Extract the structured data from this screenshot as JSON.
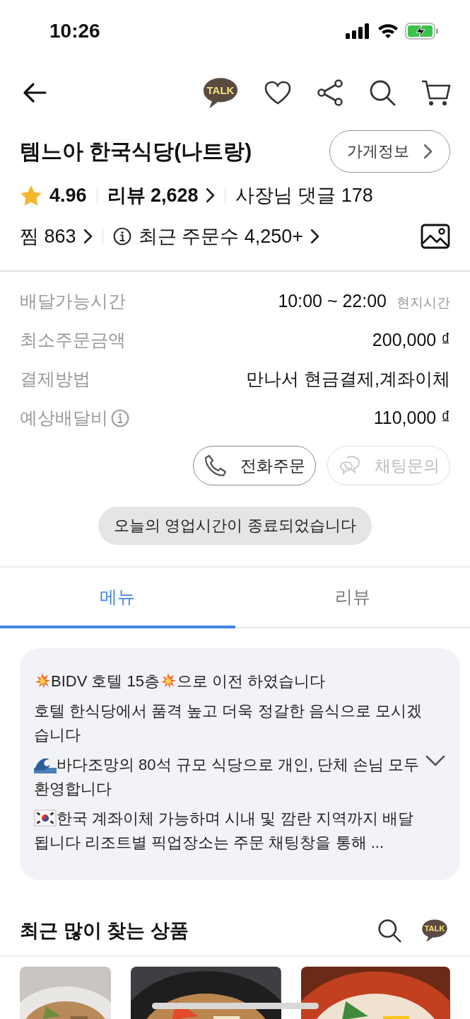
{
  "status_bar": {
    "time": "10:26"
  },
  "nav": {
    "talk_badge": "TALK"
  },
  "store": {
    "name": "템느아 한국식당(나트랑)",
    "info_button": "가게정보",
    "rating": "4.96",
    "reviews": "리뷰 2,628",
    "owner_replies": "사장님 댓글 178",
    "likes": "찜 863",
    "recent_orders": "최근 주문수 4,250+"
  },
  "info_rows": [
    {
      "label": "배달가능시간",
      "value": "10:00 ~ 22:00",
      "note": "현지시간",
      "info": false
    },
    {
      "label": "최소주문금액",
      "value": "200,000 ₫",
      "info": false
    },
    {
      "label": "결제방법",
      "value": "만나서 현금결제,계좌이체",
      "info": false
    },
    {
      "label": "예상배달비",
      "value": "110,000 ₫",
      "info": true
    }
  ],
  "contact_buttons": [
    {
      "label": "전화주문",
      "kind": "phone",
      "disabled": false
    },
    {
      "label": "채팅문의",
      "kind": "chat",
      "disabled": true
    }
  ],
  "closed_notice": "오늘의 영업시간이 종료되었습니다",
  "tabs": [
    {
      "label": "메뉴",
      "selected": true
    },
    {
      "label": "리뷰",
      "selected": false
    }
  ],
  "notice": {
    "expanded": false,
    "lines": [
      [
        {
          "kind": "burst"
        },
        {
          "kind": "text",
          "text": "BIDV 호텔 15층"
        },
        {
          "kind": "burst"
        },
        {
          "kind": "text",
          "text": "으로 이전 하였습니다"
        }
      ],
      [
        {
          "kind": "text",
          "text": "호텔 한식당에서 품격 높고 더욱 정갈한 음식으로 모시겠습니다"
        }
      ],
      [
        {
          "kind": "wave"
        },
        {
          "kind": "text",
          "text": "바다조망의 80석 규모 식당으로 개인, 단체 손님 모두 환영합니다"
        }
      ],
      [
        {
          "kind": "flag"
        },
        {
          "kind": "text",
          "text": "한국 계좌이체 가능하며 시내 및 깜란 지역까지 배달됩니다 리조트별 픽업장소는 주문 채팅창을 통해 ..."
        }
      ]
    ]
  },
  "popular": {
    "title": "최근 많이 찾는 상품",
    "talk_badge": "TALK"
  }
}
